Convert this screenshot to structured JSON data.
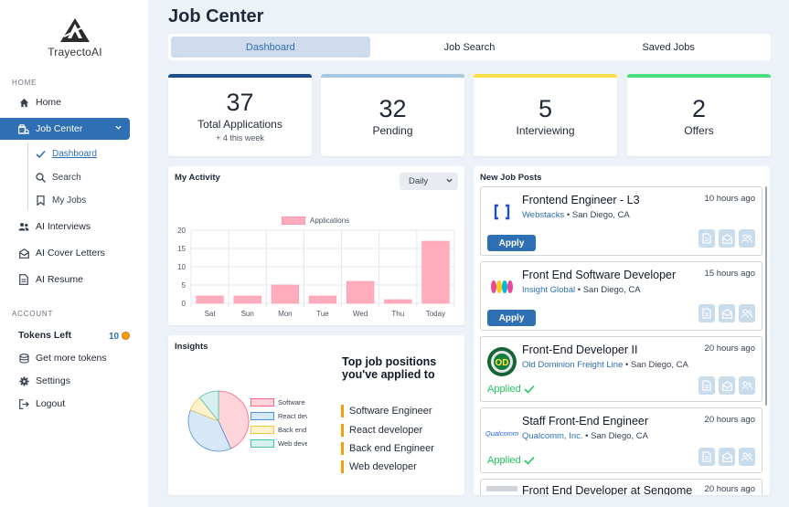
{
  "app": {
    "logo_text": "TrayectoAI"
  },
  "sidebar": {
    "home_section": "HOME",
    "items": [
      {
        "label": "Home",
        "icon": "home-icon"
      },
      {
        "label": "Job Center",
        "icon": "job-center-icon"
      },
      {
        "label": "AI Interviews",
        "icon": "people-icon"
      },
      {
        "label": "AI Cover Letters",
        "icon": "envelope-icon"
      },
      {
        "label": "AI Resume",
        "icon": "document-icon"
      }
    ],
    "sub_items": [
      {
        "label": "Dashboard",
        "icon": "check-icon"
      },
      {
        "label": "Search",
        "icon": "search-icon"
      },
      {
        "label": "My Jobs",
        "icon": "bookmark-icon"
      }
    ],
    "account_section": "ACCOUNT",
    "tokens_label": "Tokens Left",
    "tokens_count": "10",
    "account_items": [
      {
        "label": "Get more tokens",
        "icon": "coins-icon"
      },
      {
        "label": "Settings",
        "icon": "gear-icon"
      },
      {
        "label": "Logout",
        "icon": "logout-icon"
      }
    ]
  },
  "page": {
    "title": "Job Center"
  },
  "tabs": [
    "Dashboard",
    "Job Search",
    "Saved Jobs"
  ],
  "stats": [
    {
      "value": "37",
      "label": "Total Applications",
      "sub": "+ 4 this week",
      "color": "#1f4e8c"
    },
    {
      "value": "32",
      "label": "Pending",
      "sub": "",
      "color": "#a8c8e0"
    },
    {
      "value": "5",
      "label": "Interviewing",
      "sub": "",
      "color": "#fde047"
    },
    {
      "value": "2",
      "label": "Offers",
      "sub": "",
      "color": "#4ade80"
    }
  ],
  "activity": {
    "title": "My Activity",
    "period": "Daily"
  },
  "chart_data": {
    "type": "bar",
    "categories": [
      "Sat",
      "Sun",
      "Mon",
      "Tue",
      "Wed",
      "Thu",
      "Today"
    ],
    "series": [
      {
        "name": "Applications",
        "values": [
          2,
          2,
          5,
          2,
          6,
          1,
          17
        ],
        "color": "#ffadbd"
      }
    ],
    "ylim": [
      0,
      20
    ],
    "yticks": [
      0,
      5,
      10,
      15,
      20
    ],
    "grid": true,
    "legend": "top"
  },
  "insights": {
    "title": "Insights",
    "list_title": "Top job positions you've applied to",
    "positions": [
      "Software Engineer",
      "React developer",
      "Back end Engineer",
      "Web developer"
    ],
    "pie": [
      {
        "label": "Software Engineer",
        "value": 16,
        "color": "#ffd5dc",
        "border": "#ff6384"
      },
      {
        "label": "React developer",
        "value": 14,
        "color": "#d6e8f7",
        "border": "#4a90d9"
      },
      {
        "label": "Back end Engineer",
        "value": 3,
        "color": "#fff2cc",
        "border": "#f5c542"
      },
      {
        "label": "Web developer",
        "value": 4,
        "color": "#d7f0ee",
        "border": "#4bc0b0"
      }
    ]
  },
  "jobs": {
    "title": "New Job Posts",
    "apply_label": "Apply",
    "applied_label": "Applied",
    "items": [
      {
        "title": "Frontend Engineer - L3",
        "company": "Webstacks",
        "location": "San Diego, CA",
        "time": "10 hours ago",
        "status": "apply"
      },
      {
        "title": "Front End Software Developer",
        "company": "Insight Global",
        "location": "San Diego, CA",
        "time": "15 hours ago",
        "status": "apply"
      },
      {
        "title": "Front-End Developer II",
        "company": "Old Dominion Freight Line",
        "location": "San Diego, CA",
        "time": "20 hours ago",
        "status": "applied"
      },
      {
        "title": "Staff Front-End Engineer",
        "company": "Qualcomm, Inc.",
        "location": "San Diego, CA",
        "time": "20 hours ago",
        "status": "applied",
        "logo_text": "Qualcomm"
      },
      {
        "title": "Front End Developer at Sengome",
        "company": "",
        "location": "",
        "time": "20 hours ago",
        "status": ""
      }
    ]
  }
}
